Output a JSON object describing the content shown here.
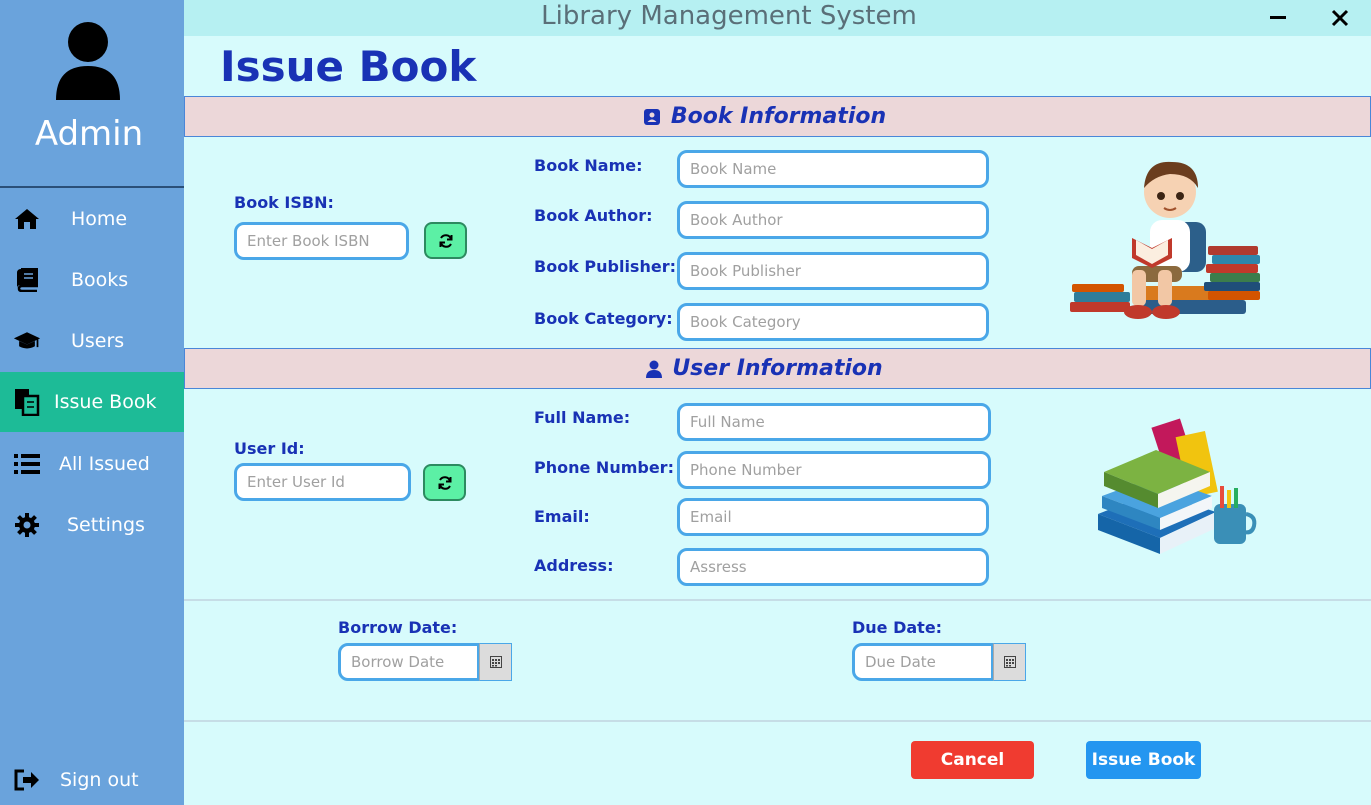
{
  "window": {
    "title": "Library Management System"
  },
  "sidebar": {
    "user_label": "Admin",
    "items": [
      {
        "label": "Home",
        "icon": "home-icon",
        "active": false
      },
      {
        "label": "Books",
        "icon": "book-icon",
        "active": false
      },
      {
        "label": "Users",
        "icon": "graduation-cap-icon",
        "active": false
      },
      {
        "label": "Issue Book",
        "icon": "issue-book-icon",
        "active": true
      },
      {
        "label": "All Issued",
        "icon": "list-icon",
        "active": false
      },
      {
        "label": "Settings",
        "icon": "gear-icon",
        "active": false
      }
    ],
    "signout_label": "Sign out"
  },
  "page": {
    "title": "Issue Book"
  },
  "book_section": {
    "title": "Book Information",
    "isbn_label": "Book ISBN:",
    "isbn_placeholder": "Enter Book ISBN",
    "name_label": "Book Name:",
    "name_placeholder": "Book Name",
    "author_label": "Book Author:",
    "author_placeholder": "Book Author",
    "publisher_label": "Book Publisher:",
    "publisher_placeholder": "Book Publisher",
    "category_label": "Book Category:",
    "category_placeholder": "Book Category"
  },
  "user_section": {
    "title": "User Information",
    "id_label": "User Id:",
    "id_placeholder": "Enter User Id",
    "fullname_label": "Full Name:",
    "fullname_placeholder": "Full Name",
    "phone_label": "Phone Number:",
    "phone_placeholder": "Phone Number",
    "email_label": "Email:",
    "email_placeholder": "Email",
    "address_label": "Address:",
    "address_placeholder": "Assress"
  },
  "dates": {
    "borrow_label": "Borrow Date:",
    "borrow_placeholder": "Borrow Date",
    "due_label": "Due Date:",
    "due_placeholder": "Due Date"
  },
  "actions": {
    "cancel_label": "Cancel",
    "issue_label": "Issue Book"
  },
  "colors": {
    "sidebar_bg": "#6aa3dc",
    "active_item": "#1dbb97",
    "content_bg": "#d7fbfc",
    "heading_blue": "#1932b5",
    "cancel_red": "#f03b30",
    "issue_blue": "#2496f0",
    "refresh_green": "#5cf0a5"
  }
}
